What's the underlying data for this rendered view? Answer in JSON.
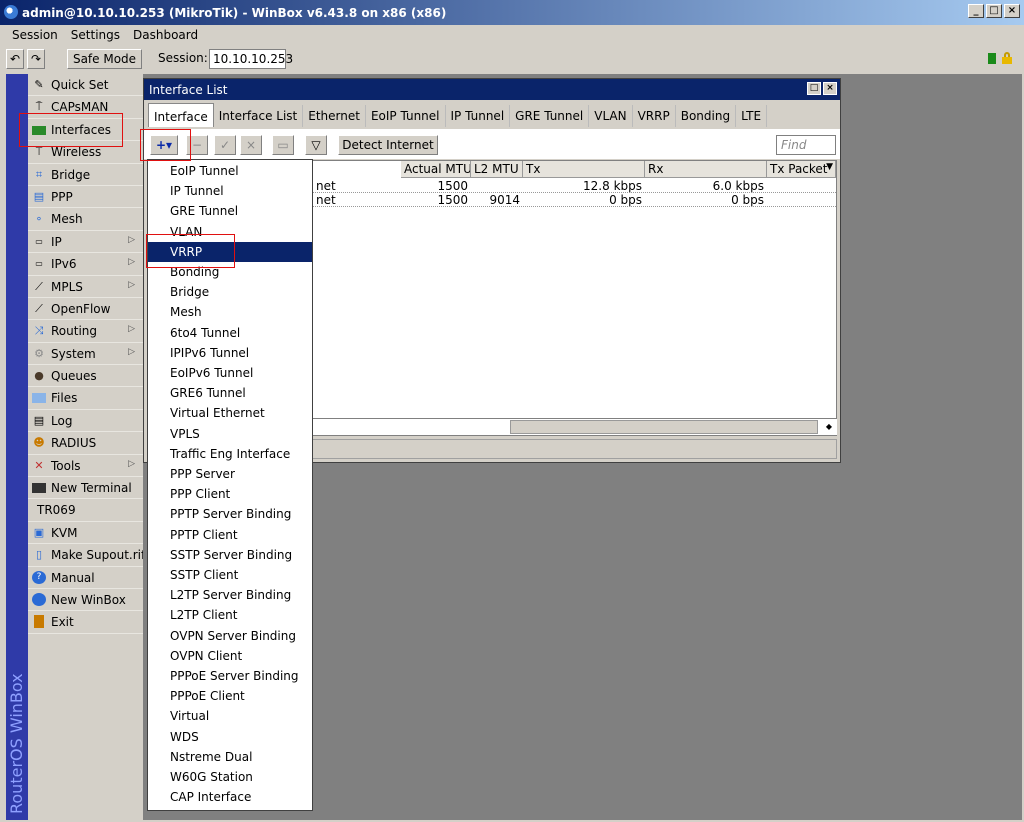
{
  "window": {
    "title": "admin@10.10.10.253 (MikroTik) - WinBox v6.43.8 on x86 (x86)"
  },
  "menu": [
    "Session",
    "Settings",
    "Dashboard"
  ],
  "toolbar": {
    "safe_mode_label": "Safe Mode",
    "session_label": "Session:",
    "session_value": "10.10.10.253"
  },
  "side_banner": "RouterOS WinBox",
  "sidebar": [
    {
      "label": "Quick Set",
      "icon": "quickset-icon"
    },
    {
      "label": "CAPsMAN",
      "icon": "antenna-icon"
    },
    {
      "label": "Interfaces",
      "icon": "interfaces-icon"
    },
    {
      "label": "Wireless",
      "icon": "wireless-icon"
    },
    {
      "label": "Bridge",
      "icon": "bridge-icon"
    },
    {
      "label": "PPP",
      "icon": "ppp-icon"
    },
    {
      "label": "Mesh",
      "icon": "mesh-icon"
    },
    {
      "label": "IP",
      "icon": "ip-icon",
      "submenu": true
    },
    {
      "label": "IPv6",
      "icon": "ipv6-icon",
      "submenu": true
    },
    {
      "label": "MPLS",
      "icon": "mpls-icon",
      "submenu": true
    },
    {
      "label": "OpenFlow",
      "icon": "openflow-icon"
    },
    {
      "label": "Routing",
      "icon": "routing-icon",
      "submenu": true
    },
    {
      "label": "System",
      "icon": "gear-icon",
      "submenu": true
    },
    {
      "label": "Queues",
      "icon": "queues-icon"
    },
    {
      "label": "Files",
      "icon": "folder-icon"
    },
    {
      "label": "Log",
      "icon": "log-icon"
    },
    {
      "label": "RADIUS",
      "icon": "radius-icon"
    },
    {
      "label": "Tools",
      "icon": "tools-icon",
      "submenu": true
    },
    {
      "label": "New Terminal",
      "icon": "terminal-icon"
    },
    {
      "label": "TR069",
      "icon": ""
    },
    {
      "label": "KVM",
      "icon": "kvm-icon"
    },
    {
      "label": "Make Supout.rif",
      "icon": "file-icon"
    },
    {
      "label": "Manual",
      "icon": "help-icon"
    },
    {
      "label": "New WinBox",
      "icon": "winbox-icon"
    },
    {
      "label": "Exit",
      "icon": "exit-icon"
    }
  ],
  "interface_window": {
    "title": "Interface List",
    "tabs": [
      "Interface",
      "Interface List",
      "Ethernet",
      "EoIP Tunnel",
      "IP Tunnel",
      "GRE Tunnel",
      "VLAN",
      "VRRP",
      "Bonding",
      "LTE"
    ],
    "detect_label": "Detect Internet",
    "find_placeholder": "Find",
    "columns": [
      "Actual MTU",
      "L2 MTU",
      "Tx",
      "Rx",
      "Tx Packet"
    ],
    "rows": [
      {
        "type": "net",
        "actual_mtu": "1500",
        "l2mtu": "",
        "tx": "12.8 kbps",
        "rx": "6.0 kbps"
      },
      {
        "type": "net",
        "actual_mtu": "1500",
        "l2mtu": "9014",
        "tx": "0 bps",
        "rx": "0 bps"
      }
    ]
  },
  "dropdown": {
    "selected": "VRRP",
    "items": [
      "EoIP Tunnel",
      "IP Tunnel",
      "GRE Tunnel",
      "VLAN",
      "VRRP",
      "Bonding",
      "Bridge",
      "Mesh",
      "6to4 Tunnel",
      "IPIPv6 Tunnel",
      "EoIPv6 Tunnel",
      "GRE6 Tunnel",
      "Virtual Ethernet",
      "VPLS",
      "Traffic Eng Interface",
      "PPP Server",
      "PPP Client",
      "PPTP Server Binding",
      "PPTP Client",
      "SSTP Server Binding",
      "SSTP Client",
      "L2TP Server Binding",
      "L2TP Client",
      "OVPN Server Binding",
      "OVPN Client",
      "PPPoE Server Binding",
      "PPPoE Client",
      "Virtual",
      "WDS",
      "Nstreme Dual",
      "W60G Station",
      "CAP Interface"
    ]
  },
  "colors": {
    "title_bar": "#0a246a",
    "selection": "#0a246a",
    "highlight_box": "#e01010",
    "banner": "#2f3aa8"
  }
}
